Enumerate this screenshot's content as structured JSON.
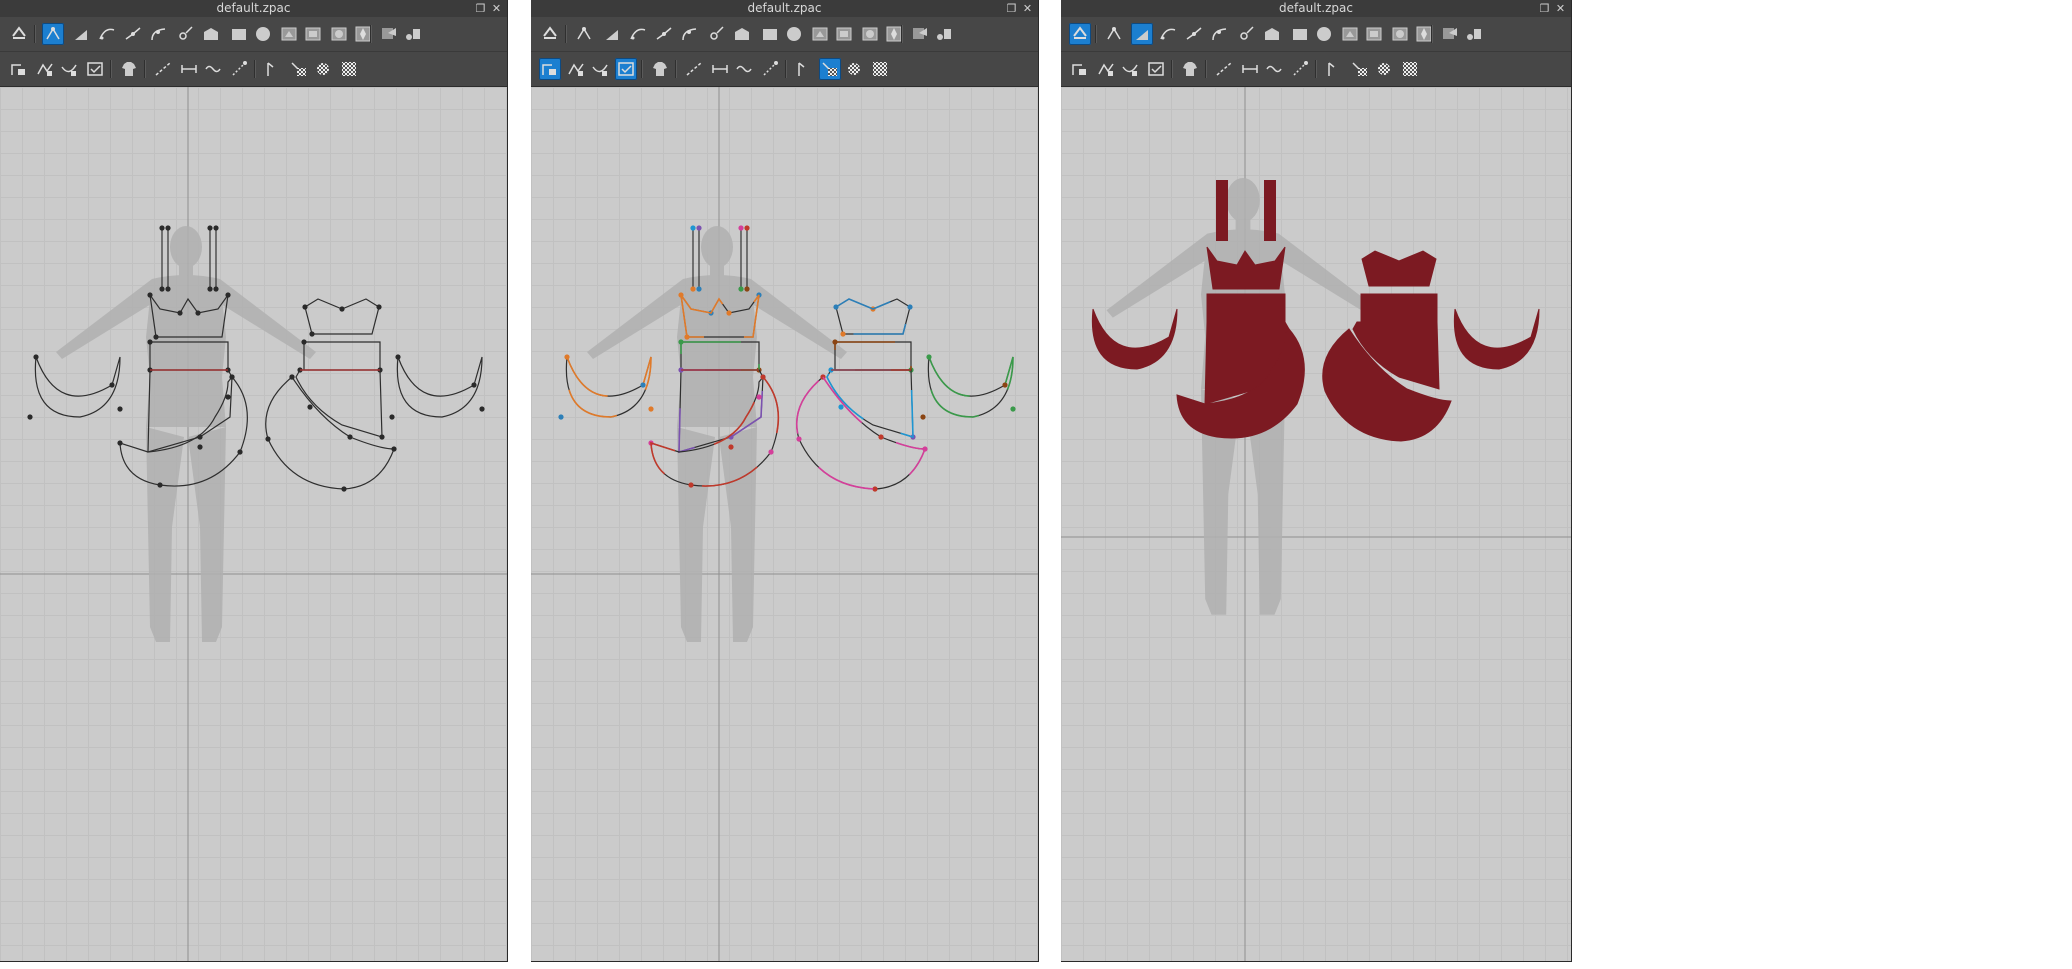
{
  "panels": [
    {
      "id": "pattern-edit",
      "title": "default.zpac",
      "active_tool": 1,
      "row2_active": [
        14
      ]
    },
    {
      "id": "seam-edit",
      "title": "default.zpac",
      "active_tool": -1,
      "row2_active": [
        0,
        3,
        10,
        14
      ]
    },
    {
      "id": "texture-view",
      "title": "default.zpac",
      "active_tool": 0,
      "row2_active": [
        14
      ],
      "row1_extra_active": [
        2
      ]
    }
  ],
  "icons": {
    "toolbar_row1": [
      "transform-icon",
      "edit-pattern-icon",
      "edit-point-icon",
      "edit-curve-point-icon",
      "add-point-icon",
      "curve-point-icon",
      "sewing-point-icon",
      "polygon-icon",
      "rectangle-icon",
      "circle-icon",
      "internal-polygon-icon",
      "internal-rectangle-icon",
      "internal-circle-icon",
      "dart-icon",
      "trace-icon",
      "fold-arrangement-icon"
    ],
    "toolbar_row2": [
      "transform-arrange-icon",
      "segment-sewing-icon",
      "free-sewing-icon",
      "check-sewing-icon",
      "show-3d-garment-icon",
      "edit-sewing-icon",
      "segment-length-icon",
      "tape-icon",
      "pin-icon",
      "baseline-icon",
      "texture-icon",
      "graphic-icon",
      "pattern-grid-icon",
      "show-texture-icon"
    ]
  },
  "colors": {
    "fabric": "#7c1a22",
    "outline": "#2e2e2e",
    "avatar": "#b0b0b0",
    "active_tool": "#1c7fd0",
    "seam_palette": [
      "#1e96d2",
      "#d43f9a",
      "#e07a2a",
      "#3a9a4a",
      "#7b52b0",
      "#c0392b",
      "#2c7fb8",
      "#8b4513"
    ]
  },
  "window_controls": {
    "restore_glyph": "❐",
    "close_glyph": "✕"
  }
}
